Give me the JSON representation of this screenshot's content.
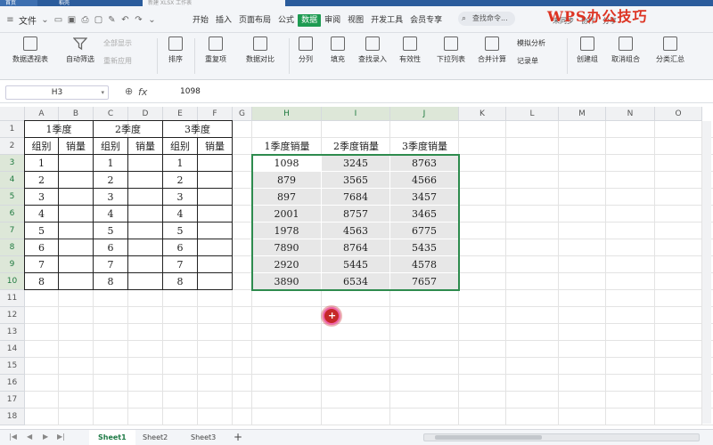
{
  "app": {
    "brand": "WPS办公技巧",
    "tabs": [
      "首页",
      "稻壳",
      "新建 XLSX 工作表"
    ]
  },
  "menu": {
    "file_label": "文件",
    "tabs": [
      "开始",
      "插入",
      "页面布局",
      "公式",
      "数据",
      "审阅",
      "视图",
      "开发工具",
      "会员专享"
    ],
    "active_tab": "数据",
    "search_placeholder": "查找命令...",
    "right": [
      "未同步",
      "协作",
      "分享"
    ]
  },
  "ribbon": {
    "buttons": [
      "数据透视表",
      "自动筛选",
      "排序",
      "重复项",
      "数据对比",
      "分列",
      "填充",
      "查找录入",
      "有效性",
      "下拉列表",
      "合并计算",
      "创建组",
      "取消组合",
      "分类汇总"
    ],
    "small": [
      "全部显示",
      "重新应用",
      "模拟分析",
      "记录单"
    ]
  },
  "formula_bar": {
    "name_box": "H3",
    "fx": "fx",
    "value": "1098"
  },
  "columns": [
    "A",
    "B",
    "C",
    "D",
    "E",
    "F",
    "G",
    "H",
    "I",
    "J",
    "K",
    "L",
    "M",
    "N",
    "O"
  ],
  "rows": [
    "1",
    "2",
    "3",
    "4",
    "5",
    "6",
    "7",
    "8",
    "9",
    "10",
    "11",
    "12",
    "13",
    "14",
    "15",
    "16",
    "17",
    "18"
  ],
  "left_table": {
    "groups": [
      "1季度",
      "2季度",
      "3季度"
    ],
    "subheaders": [
      "组别",
      "销量",
      "组别",
      "销量",
      "组别",
      "销量"
    ],
    "group_ids": [
      "1",
      "2",
      "3",
      "4",
      "5",
      "6",
      "7",
      "8"
    ]
  },
  "right_table": {
    "headers": [
      "1季度销量",
      "2季度销量",
      "3季度销量"
    ],
    "rows": [
      [
        "1098",
        "3245",
        "8763"
      ],
      [
        "879",
        "3565",
        "4566"
      ],
      [
        "897",
        "7684",
        "3457"
      ],
      [
        "2001",
        "8757",
        "3465"
      ],
      [
        "1978",
        "4563",
        "6775"
      ],
      [
        "7890",
        "8764",
        "5435"
      ],
      [
        "2920",
        "5445",
        "4578"
      ],
      [
        "3890",
        "6534",
        "7657"
      ]
    ]
  },
  "sheets": [
    "Sheet1",
    "Sheet2",
    "Sheet3"
  ],
  "active_sheet": "Sheet1",
  "add_sheet": "+"
}
